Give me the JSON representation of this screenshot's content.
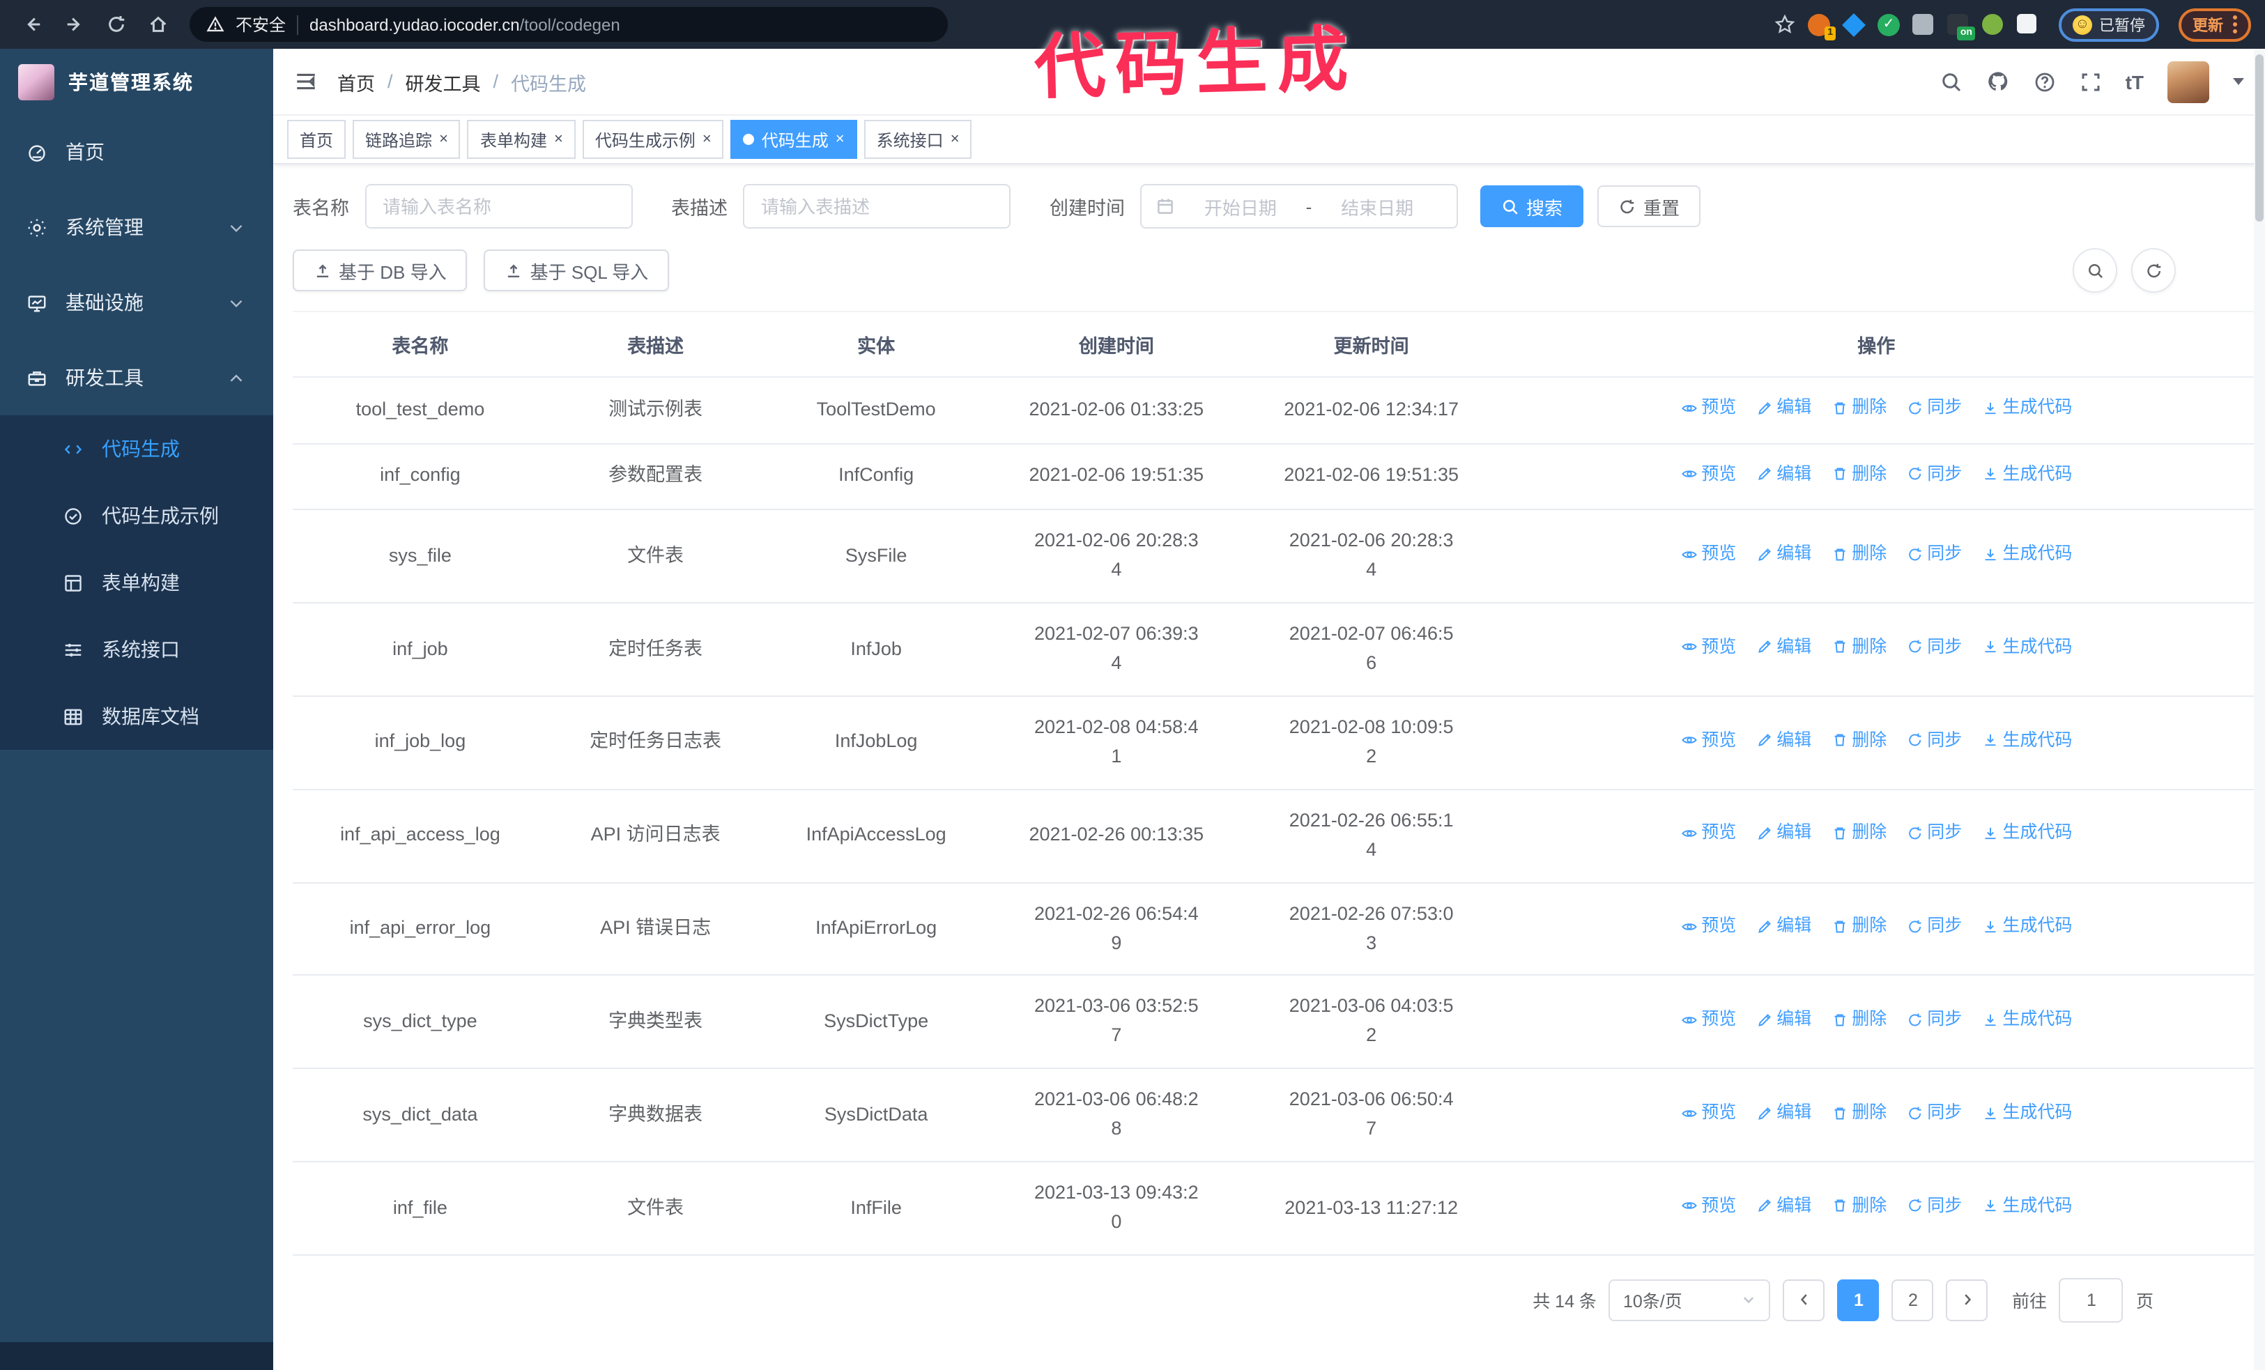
{
  "browser": {
    "security_label": "不安全",
    "url_domain": "dashboard.yudao.iocoder.cn",
    "url_path": "/tool/codegen",
    "profile_label": "已暂停",
    "update_label": "更新",
    "extensions": [
      {
        "slug": "ext-orange",
        "badge": "1"
      },
      {
        "slug": "ext-blue-diamond",
        "badge": ""
      },
      {
        "slug": "ext-green-check",
        "badge": ""
      },
      {
        "slug": "ext-grid",
        "badge": ""
      },
      {
        "slug": "ext-dark",
        "badge": "on"
      },
      {
        "slug": "ext-green-bot",
        "badge": ""
      },
      {
        "slug": "ext-puzzle",
        "badge": ""
      }
    ]
  },
  "annotation": {
    "text": "代码生成",
    "color": "#fb2e57"
  },
  "app": {
    "title": "芋道管理系统"
  },
  "breadcrumb": {
    "items": [
      "首页",
      "研发工具",
      "代码生成"
    ],
    "separator": "/"
  },
  "sidebar": {
    "items": [
      {
        "slug": "home",
        "icon": "dashboard-icon",
        "label": "首页",
        "chevron": ""
      },
      {
        "slug": "system-mgmt",
        "icon": "gear-icon",
        "label": "系统管理",
        "chevron": "down"
      },
      {
        "slug": "infrastructure",
        "icon": "infra-icon",
        "label": "基础设施",
        "chevron": "down"
      },
      {
        "slug": "dev-tools",
        "icon": "tools-icon",
        "label": "研发工具",
        "chevron": "up"
      }
    ],
    "submenu": [
      {
        "slug": "codegen",
        "icon": "code-icon",
        "label": "代码生成",
        "active": true
      },
      {
        "slug": "codegen-example",
        "icon": "example-icon",
        "label": "代码生成示例",
        "active": false
      },
      {
        "slug": "form-builder",
        "icon": "form-icon",
        "label": "表单构建",
        "active": false
      },
      {
        "slug": "system-api",
        "icon": "api-icon",
        "label": "系统接口",
        "active": false
      },
      {
        "slug": "db-doc",
        "icon": "dbdoc-icon",
        "label": "数据库文档",
        "active": false
      }
    ]
  },
  "tabs": [
    {
      "slug": "home",
      "label": "首页",
      "closable": false,
      "active": false
    },
    {
      "slug": "tracing",
      "label": "链路追踪",
      "closable": true,
      "active": false
    },
    {
      "slug": "form-builder",
      "label": "表单构建",
      "closable": true,
      "active": false
    },
    {
      "slug": "codegen-example",
      "label": "代码生成示例",
      "closable": true,
      "active": false
    },
    {
      "slug": "codegen",
      "label": "代码生成",
      "closable": true,
      "active": true
    },
    {
      "slug": "system-api",
      "label": "系统接口",
      "closable": true,
      "active": false
    }
  ],
  "form": {
    "name_label": "表名称",
    "name_placeholder": "请输入表名称",
    "desc_label": "表描述",
    "desc_placeholder": "请输入表描述",
    "time_label": "创建时间",
    "start_placeholder": "开始日期",
    "range_separator": "-",
    "end_placeholder": "结束日期",
    "search_label": "搜索",
    "reset_label": "重置"
  },
  "toolbar": {
    "import_db_label": "基于 DB 导入",
    "import_sql_label": "基于 SQL 导入"
  },
  "table": {
    "headers": [
      "表名称",
      "表描述",
      "实体",
      "创建时间",
      "更新时间",
      "操作"
    ],
    "actions": [
      {
        "slug": "preview",
        "icon": "eye-icon",
        "label": "预览"
      },
      {
        "slug": "edit",
        "icon": "edit-icon",
        "label": "编辑"
      },
      {
        "slug": "delete",
        "icon": "delete-icon",
        "label": "删除"
      },
      {
        "slug": "sync",
        "icon": "sync-icon",
        "label": "同步"
      },
      {
        "slug": "generate-code",
        "icon": "download-icon",
        "label": "生成代码"
      }
    ],
    "rows": [
      {
        "name": "tool_test_demo",
        "desc": "测试示例表",
        "entity": "ToolTestDemo",
        "created": "2021-02-06 01:33:25",
        "updated": "2021-02-06 12:34:17"
      },
      {
        "name": "inf_config",
        "desc": "参数配置表",
        "entity": "InfConfig",
        "created": "2021-02-06 19:51:35",
        "updated": "2021-02-06 19:51:35"
      },
      {
        "name": "sys_file",
        "desc": "文件表",
        "entity": "SysFile",
        "created": "2021-02-06 20:28:3\n4",
        "updated": "2021-02-06 20:28:3\n4"
      },
      {
        "name": "inf_job",
        "desc": "定时任务表",
        "entity": "InfJob",
        "created": "2021-02-07 06:39:3\n4",
        "updated": "2021-02-07 06:46:5\n6"
      },
      {
        "name": "inf_job_log",
        "desc": "定时任务日志表",
        "entity": "InfJobLog",
        "created": "2021-02-08 04:58:4\n1",
        "updated": "2021-02-08 10:09:5\n2"
      },
      {
        "name": "inf_api_access_log",
        "desc": "API 访问日志表",
        "entity": "InfApiAccessLog",
        "created": "2021-02-26 00:13:35",
        "updated": "2021-02-26 06:55:1\n4"
      },
      {
        "name": "inf_api_error_log",
        "desc": "API 错误日志",
        "entity": "InfApiErrorLog",
        "created": "2021-02-26 06:54:4\n9",
        "updated": "2021-02-26 07:53:0\n3"
      },
      {
        "name": "sys_dict_type",
        "desc": "字典类型表",
        "entity": "SysDictType",
        "created": "2021-03-06 03:52:5\n7",
        "updated": "2021-03-06 04:03:5\n2"
      },
      {
        "name": "sys_dict_data",
        "desc": "字典数据表",
        "entity": "SysDictData",
        "created": "2021-03-06 06:48:2\n8",
        "updated": "2021-03-06 06:50:4\n7"
      },
      {
        "name": "inf_file",
        "desc": "文件表",
        "entity": "InfFile",
        "created": "2021-03-13 09:43:2\n0",
        "updated": "2021-03-13 11:27:12"
      }
    ]
  },
  "pagination": {
    "total_label": "共 14 条",
    "page_size_label": "10条/页",
    "pages": [
      "1",
      "2"
    ],
    "active_page": "1",
    "goto_label": "前往",
    "goto_value": "1",
    "page_suffix": "页"
  },
  "colors": {
    "primary": "#409eff",
    "sidebar_bg": "#264763",
    "submenu_bg": "#1b334f",
    "annotation": "#fb2e57"
  }
}
